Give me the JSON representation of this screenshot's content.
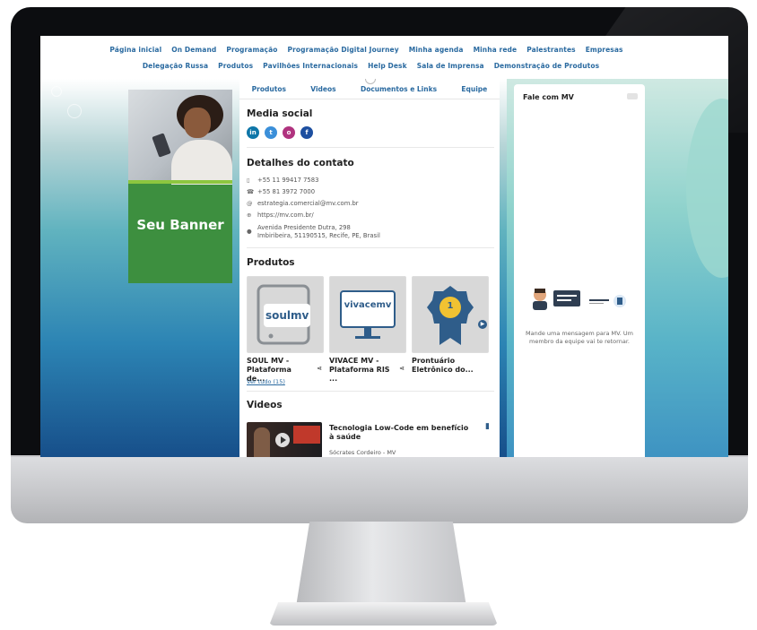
{
  "nav": {
    "row1": [
      "Página inicial",
      "On Demand",
      "Programação",
      "Programação Digital Journey",
      "Minha agenda",
      "Minha rede",
      "Palestrantes",
      "Empresas"
    ],
    "row2": [
      "Delegação Russa",
      "Produtos",
      "Pavilhões Internacionais",
      "Help Desk",
      "Sala de Imprensa",
      "Demonstração de Produtos"
    ]
  },
  "banner": {
    "text": "Seu Banner"
  },
  "tabs": [
    "Produtos",
    "Videos",
    "Documentos e Links",
    "Equipe"
  ],
  "social": {
    "title": "Media social",
    "icons": [
      "linkedin-icon",
      "twitter-icon",
      "instagram-icon",
      "facebook-icon"
    ],
    "letters": [
      "in",
      "t",
      "o",
      "f"
    ]
  },
  "contact": {
    "title": "Detalhes do contato",
    "mobile": "+55 11 99417 7583",
    "phone": "+55 81 3972 7000",
    "email": "estrategia.comercial@mv.com.br",
    "website": "https://mv.com.br/",
    "address_line1": "Avenida Presidente Dutra, 298",
    "address_line2": "Imbiribeira, 51190515, Recife, PE, Brasil"
  },
  "products": {
    "title": "Produtos",
    "items": [
      {
        "name_line1": "SOUL MV -",
        "name_line2": "Plataforma de...",
        "logo": "soulmv"
      },
      {
        "name_line1": "VIVACE MV -",
        "name_line2": "Plataforma RIS ...",
        "logo": "vivacemv"
      },
      {
        "name_line1": "Prontuário",
        "name_line2": "Eletrônico do...",
        "logo": "1"
      }
    ],
    "see_all": "Ver tudo (15)"
  },
  "videos": {
    "title": "Videos",
    "items": [
      {
        "title": "Tecnologia Low-Code em benefício à saúde",
        "author": "Sócrates Cordeiro - MV"
      }
    ]
  },
  "chat": {
    "title": "Fale com MV",
    "empty_message": "Mande uma mensagem para MV. Um membro da equipe vai te retornar."
  },
  "colors": {
    "link": "#2a6aa0",
    "banner_green": "#3d8f3f",
    "linkedin": "#0e76a8",
    "twitter": "#3b8fd9",
    "instagram": "#b0337f",
    "facebook": "#1d4fa0"
  }
}
